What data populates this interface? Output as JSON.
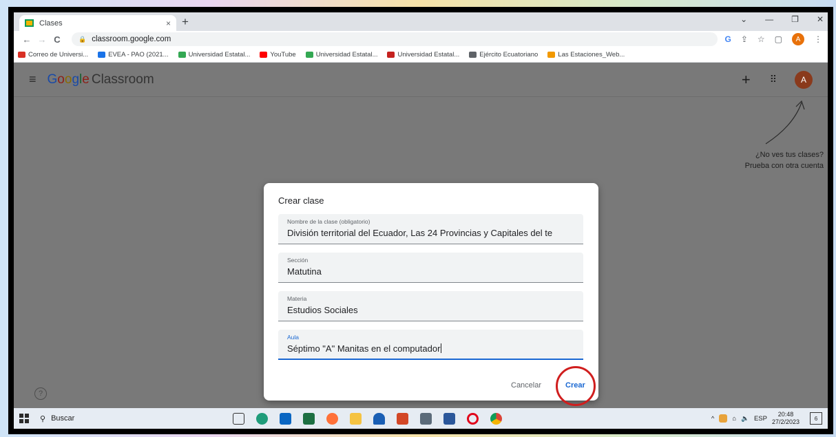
{
  "browser": {
    "tab_title": "Clases",
    "tab_close": "×",
    "new_tab": "+",
    "url": "classroom.google.com",
    "window_controls": [
      "⌄",
      "—",
      "❐",
      "✕"
    ],
    "nav": {
      "back": "←",
      "forward": "→",
      "reload": "C"
    },
    "toolbar_icons": {
      "google": "G",
      "share": "⇪",
      "star": "☆",
      "sidepanel": "▢",
      "profile": "A",
      "menu": "⋮"
    },
    "bookmarks": [
      {
        "label": "Correo de Universi...",
        "color": "#d93025"
      },
      {
        "label": "EVEA - PAO (2021...",
        "color": "#1a73e8"
      },
      {
        "label": "Universidad Estatal...",
        "color": "#34a853"
      },
      {
        "label": "YouTube",
        "color": "#ff0000"
      },
      {
        "label": "Universidad Estatal...",
        "color": "#34a853"
      },
      {
        "label": "Universidad Estatal...",
        "color": "#c5221f"
      },
      {
        "label": "Ejército Ecuatoriano",
        "color": "#5f6368"
      },
      {
        "label": "Las Estaciones_Web...",
        "color": "#f29900"
      }
    ]
  },
  "app": {
    "logo": {
      "g": "G",
      "o1": "o",
      "o2": "o",
      "g2": "g",
      "l": "l",
      "e": "e",
      "product": "Classroom"
    },
    "header_icons": {
      "menu": "≡",
      "add": "+",
      "apps": "⠿",
      "avatar": "A"
    },
    "hint_line1": "¿No ves tus clases?",
    "hint_line2": "Prueba con otra cuenta",
    "help": "?"
  },
  "dialog": {
    "title": "Crear clase",
    "fields": [
      {
        "label": "Nombre de la clase (obligatorio)",
        "value": "División territorial del Ecuador,  Las 24 Provincias y Capitales del te"
      },
      {
        "label": "Sección",
        "value": "Matutina"
      },
      {
        "label": "Materia",
        "value": "Estudios Sociales"
      },
      {
        "label": "Aula",
        "value": "Séptimo \"A\" Manitas en el computador"
      }
    ],
    "cancel": "Cancelar",
    "create": "Crear"
  },
  "taskbar": {
    "search": "Buscar",
    "apps": [
      "task-view",
      "edge",
      "mail",
      "excel",
      "firefox",
      "explorer",
      "headset",
      "powerpoint",
      "camera",
      "word",
      "opera",
      "chrome"
    ],
    "tray_language": "ESP",
    "time": "20:48",
    "date": "27/2/2023",
    "notifications": "6",
    "tray_up": "^"
  }
}
